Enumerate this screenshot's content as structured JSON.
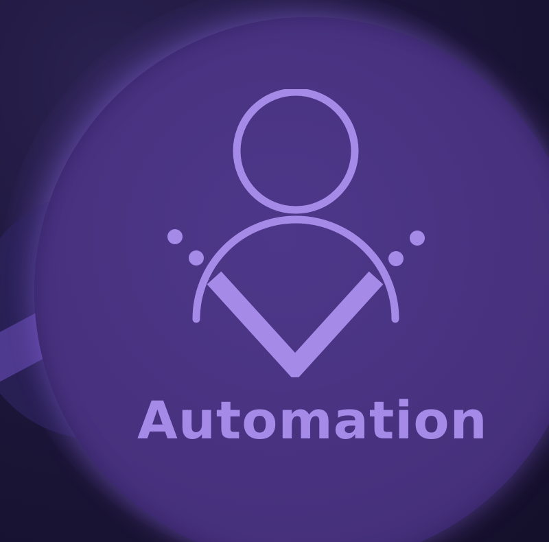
{
  "label": "Automation",
  "icon": "person-checkmark-icon",
  "colors": {
    "background": "#1b1538",
    "disc": "#48327f",
    "accent": "#a68ae8"
  }
}
